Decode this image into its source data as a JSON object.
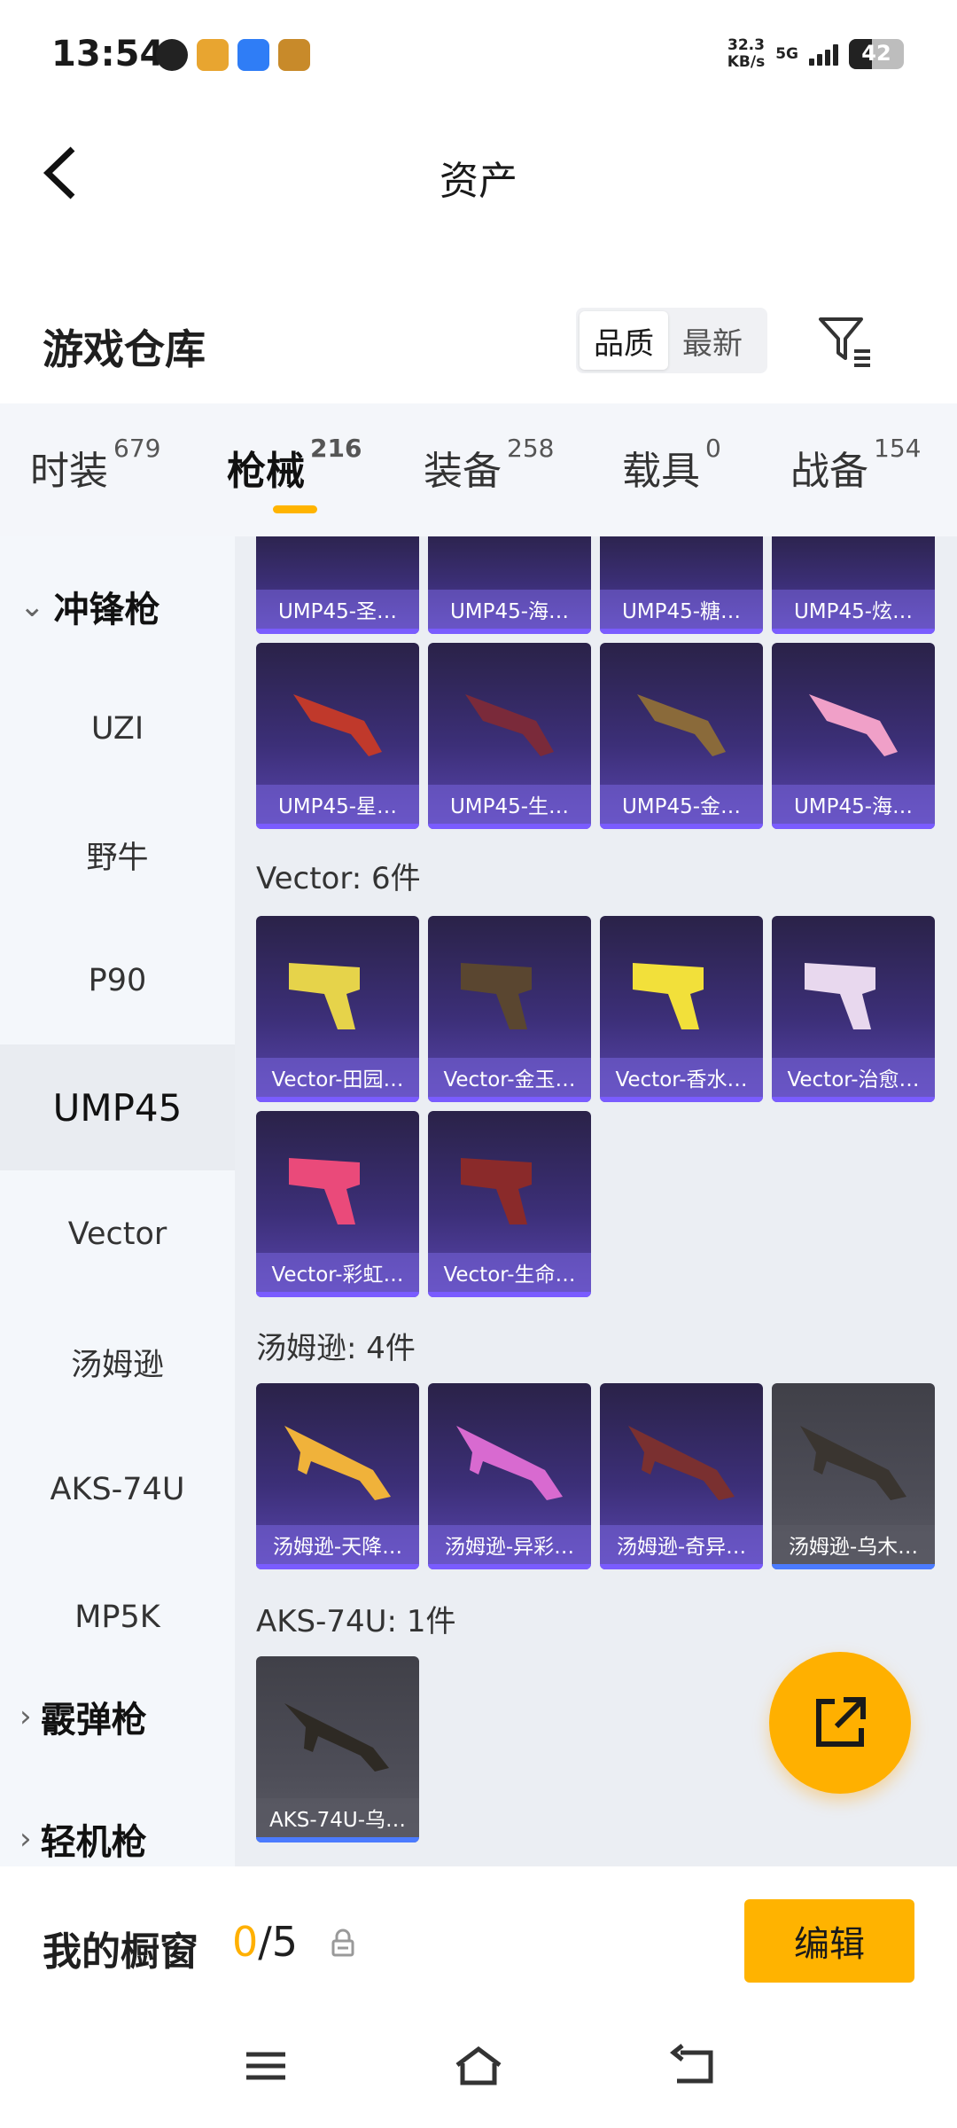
{
  "status_bar": {
    "time": "13:54",
    "speed_value": "32.3",
    "speed_unit": "KB/s",
    "network": "5G",
    "battery": "42",
    "icons": [
      "app-icon-1",
      "app-icon-2",
      "app-icon-3",
      "app-icon-4"
    ]
  },
  "header": {
    "title": "资产",
    "back_icon": "chevron-left-icon"
  },
  "section": {
    "title": "游戏仓库",
    "sort_options": [
      "品质",
      "最新"
    ],
    "sort_selected": "品质",
    "filter_icon": "filter-icon"
  },
  "tabs": [
    {
      "label": "时装",
      "count": "679"
    },
    {
      "label": "枪械",
      "count": "216"
    },
    {
      "label": "装备",
      "count": "258"
    },
    {
      "label": "载具",
      "count": "0"
    },
    {
      "label": "战备",
      "count": "154"
    }
  ],
  "active_tab": "枪械",
  "sidebar": {
    "category_open": "冲锋枪",
    "items": [
      "UZI",
      "野牛",
      "P90",
      "UMP45",
      "Vector",
      "汤姆逊",
      "AKS-74U",
      "MP5K"
    ],
    "active_item": "UMP45",
    "category_closed": "霰弹枪",
    "category_partial": "轻机枪"
  },
  "content": {
    "ump_top_row": [
      "UMP45-圣…",
      "UMP45-海…",
      "UMP45-糖…",
      "UMP45-炫…"
    ],
    "ump_second_row": [
      "UMP45-星…",
      "UMP45-生…",
      "UMP45-金…",
      "UMP45-海…"
    ],
    "vector_label": "Vector: 6件",
    "vector_items": [
      "Vector-田园…",
      "Vector-金玉…",
      "Vector-香水…",
      "Vector-治愈…",
      "Vector-彩虹…",
      "Vector-生命…"
    ],
    "tommy_label": "汤姆逊: 4件",
    "tommy_items": [
      "汤姆逊-天降…",
      "汤姆逊-异彩…",
      "汤姆逊-奇异…",
      "汤姆逊-乌木…"
    ],
    "aks_label": "AKS-74U: 1件",
    "aks_items": [
      "AKS-74U-乌…"
    ]
  },
  "fab": {
    "icon": "share-external-icon"
  },
  "bottom": {
    "showcase_label": "我的橱窗",
    "showcase_current": "0",
    "showcase_total": "/5",
    "lock_icon": "lock-icon",
    "edit_label": "编辑"
  },
  "colors": {
    "accent": "#ffb000",
    "card_purple": "#3c2f78",
    "card_grey": "#4d4d57"
  }
}
